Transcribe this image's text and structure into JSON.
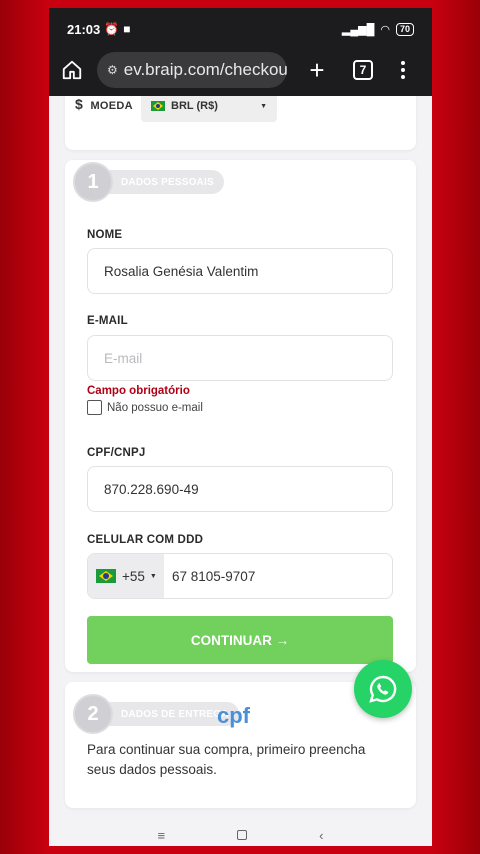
{
  "status_bar": {
    "time": "21:03",
    "battery": "70"
  },
  "browser": {
    "url": "ev.braip.com/checkou",
    "tab_count": "7"
  },
  "currency": {
    "label": "MOEDA",
    "symbol": "$",
    "selected": "BRL (R$)"
  },
  "personal_step": {
    "number": "1",
    "title": "DADOS PESSOAIS",
    "fields": {
      "name": {
        "label": "NOME",
        "value": "Rosalia Genésia Valentim"
      },
      "email": {
        "label": "E-MAIL",
        "placeholder": "E-mail",
        "error": "Campo obrigatório",
        "no_email_label": "Não possuo e-mail"
      },
      "cpf": {
        "label": "CPF/CNPJ",
        "value": "870.228.690-49"
      },
      "phone": {
        "label": "CELULAR COM DDD",
        "ddi": "+55",
        "value": "67 8105-9707"
      }
    },
    "continue_label": "CONTINUAR →"
  },
  "delivery_step": {
    "number": "2",
    "title": "DADOS DE ENTREGA",
    "message": "Para continuar sua compra, primeiro preencha seus dados pessoais."
  },
  "overlay_text": "cpf",
  "colors": {
    "background_red": "#c8000f",
    "continue_green": "#72d15c",
    "error_red": "#b00015",
    "whatsapp_green": "#25d366"
  }
}
